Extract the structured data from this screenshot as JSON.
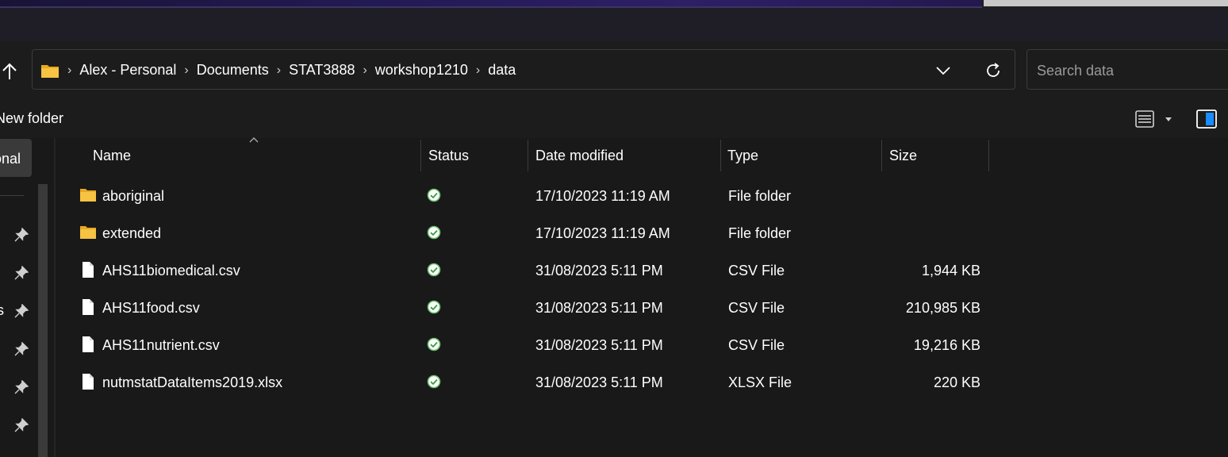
{
  "address": {
    "crumbs": [
      "Alex - Personal",
      "Documents",
      "STAT3888",
      "workshop1210",
      "data"
    ]
  },
  "search": {
    "placeholder": "Search data"
  },
  "toolbar": {
    "new_folder_label": "New folder"
  },
  "sidebar": {
    "selected_fragment": "onal",
    "fragments": [
      ":",
      "s"
    ]
  },
  "columns": {
    "name": "Name",
    "status": "Status",
    "date": "Date modified",
    "type": "Type",
    "size": "Size"
  },
  "files": [
    {
      "name": "aboriginal",
      "kind": "folder",
      "date": "17/10/2023 11:19 AM",
      "type": "File folder",
      "size": ""
    },
    {
      "name": "extended",
      "kind": "folder",
      "date": "17/10/2023 11:19 AM",
      "type": "File folder",
      "size": ""
    },
    {
      "name": "AHS11biomedical.csv",
      "kind": "file",
      "date": "31/08/2023 5:11 PM",
      "type": "CSV File",
      "size": "1,944 KB"
    },
    {
      "name": "AHS11food.csv",
      "kind": "file",
      "date": "31/08/2023 5:11 PM",
      "type": "CSV File",
      "size": "210,985 KB"
    },
    {
      "name": "AHS11nutrient.csv",
      "kind": "file",
      "date": "31/08/2023 5:11 PM",
      "type": "CSV File",
      "size": "19,216 KB"
    },
    {
      "name": "nutmstatDataItems2019.xlsx",
      "kind": "file",
      "date": "31/08/2023 5:11 PM",
      "type": "XLSX File",
      "size": "220 KB"
    }
  ],
  "icons": {
    "up": "up-arrow-icon",
    "folder": "folder-icon",
    "file": "file-icon",
    "status": "sync-ok-icon",
    "chevron": "chevron-down-icon",
    "refresh": "refresh-icon",
    "pin": "pin-icon",
    "details": "details-view-icon",
    "preview": "preview-pane-icon"
  },
  "colors": {
    "folder": "#f6c342",
    "status_ok": "#6cc070",
    "background": "#191919",
    "accent": "#0a84ff"
  }
}
